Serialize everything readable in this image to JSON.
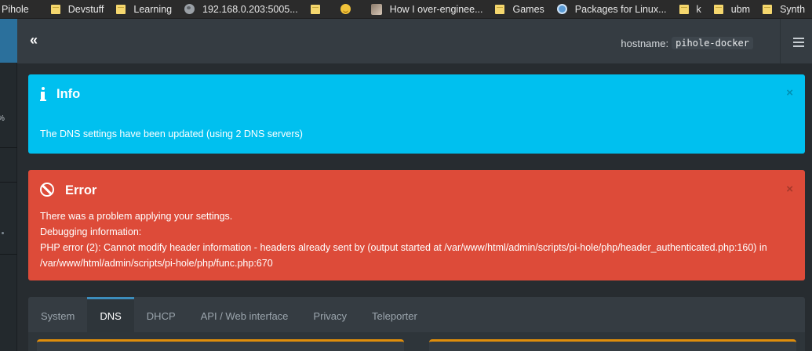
{
  "bookmarks": [
    {
      "label": "Pihole",
      "icon": "none"
    },
    {
      "label": "Devstuff",
      "icon": "folder-icon"
    },
    {
      "label": "Learning",
      "icon": "folder-icon"
    },
    {
      "label": "192.168.0.203:5005...",
      "icon": "globe-icon"
    },
    {
      "label": "",
      "icon": "folder-icon"
    },
    {
      "label": "",
      "icon": "emoji-icon"
    },
    {
      "label": "How I over-enginee...",
      "icon": "avatar-icon"
    },
    {
      "label": "Games",
      "icon": "folder-icon"
    },
    {
      "label": "Packages for Linux...",
      "icon": "search-icon"
    },
    {
      "label": "k",
      "icon": "folder-icon"
    },
    {
      "label": "ubm",
      "icon": "folder-icon"
    },
    {
      "label": "Synth",
      "icon": "folder-icon"
    }
  ],
  "sidebar": {
    "percent_text": "%"
  },
  "header": {
    "collapse_label": "«",
    "hostname_label": "hostname:",
    "hostname_value": "pihole-docker"
  },
  "alerts": {
    "info": {
      "title": "Info",
      "close": "×",
      "message": "The DNS settings have been updated (using 2 DNS servers)"
    },
    "error": {
      "title": "Error",
      "close": "×",
      "line1": "There was a problem applying your settings.",
      "line2": "Debugging information:",
      "line3": "PHP error (2): Cannot modify header information - headers already sent by (output started at /var/www/html/admin/scripts/pi-hole/php/header_authenticated.php:160) in /var/www/html/admin/scripts/pi-hole/php/func.php:670"
    }
  },
  "tabs": [
    {
      "label": "System",
      "active": false
    },
    {
      "label": "DNS",
      "active": true
    },
    {
      "label": "DHCP",
      "active": false
    },
    {
      "label": "API / Web interface",
      "active": false
    },
    {
      "label": "Privacy",
      "active": false
    },
    {
      "label": "Teleporter",
      "active": false
    }
  ],
  "colors": {
    "info": "#00c0ef",
    "error": "#dd4b39",
    "accent": "#3c8dbc",
    "warning_border": "#e08e0b"
  }
}
